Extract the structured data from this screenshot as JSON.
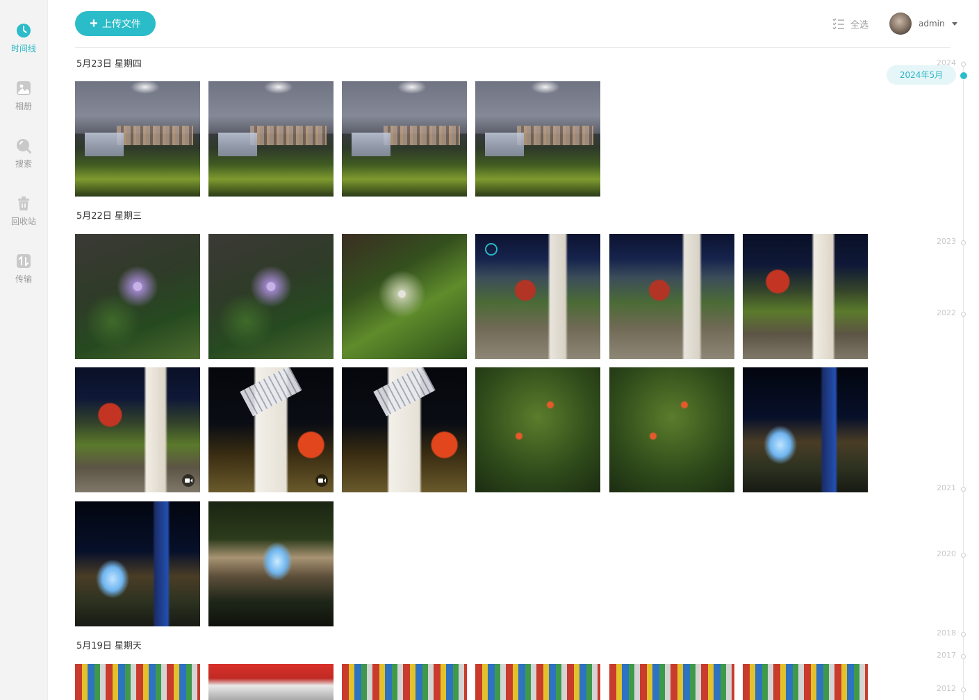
{
  "sidebar": {
    "items": [
      {
        "label": "时间线",
        "icon": "clock-icon",
        "active": true
      },
      {
        "label": "相册",
        "icon": "image-icon",
        "active": false
      },
      {
        "label": "搜索",
        "icon": "search-icon",
        "active": false
      },
      {
        "label": "回收站",
        "icon": "trash-icon",
        "active": false
      },
      {
        "label": "传输",
        "icon": "transfer-icon",
        "active": false
      }
    ]
  },
  "header": {
    "upload_label": "上传文件",
    "select_all_label": "全选",
    "username": "admin"
  },
  "groups": [
    {
      "date": "5月23日",
      "weekday": "星期四",
      "count": 4,
      "videos": []
    },
    {
      "date": "5月22日",
      "weekday": "星期三",
      "count": 14,
      "videos": [
        7,
        8
      ]
    },
    {
      "date": "5月19日",
      "weekday": "星期天",
      "count": 6,
      "videos": []
    }
  ],
  "timeline": {
    "current": "2024年5月",
    "years": [
      "2024",
      "2023",
      "2022",
      "2021",
      "2020",
      "2018",
      "2017",
      "2012"
    ]
  },
  "colors": {
    "accent": "#2bbcc9",
    "sidebar_bg": "#f3f3f3"
  }
}
